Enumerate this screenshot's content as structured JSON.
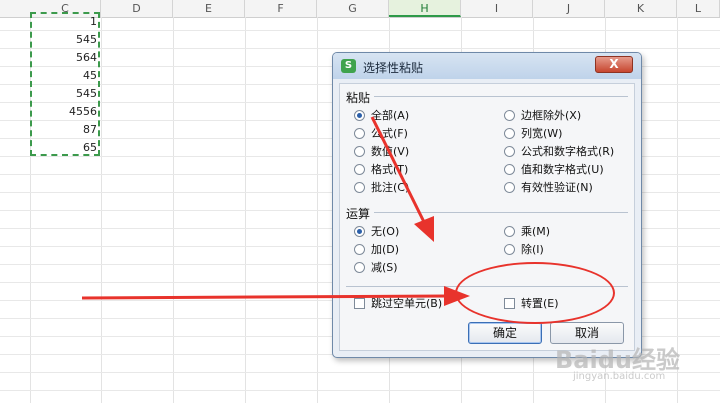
{
  "columns": [
    "C",
    "D",
    "E",
    "F",
    "G",
    "H",
    "I",
    "J",
    "K",
    "L"
  ],
  "selected_column": "H",
  "cells": [
    "1",
    "545",
    "564",
    "45",
    "545",
    "4556",
    "87",
    "65"
  ],
  "dialog": {
    "title": "选择性粘贴",
    "app_icon": "S",
    "close_label": "X",
    "paste_label": "粘贴",
    "paste_options": [
      {
        "label": "全部(A)",
        "checked": true
      },
      {
        "label": "公式(F)",
        "checked": false
      },
      {
        "label": "数值(V)",
        "checked": false
      },
      {
        "label": "格式(T)",
        "checked": false
      },
      {
        "label": "批注(C)",
        "checked": false
      },
      {
        "label": "边框除外(X)",
        "checked": false
      },
      {
        "label": "列宽(W)",
        "checked": false
      },
      {
        "label": "公式和数字格式(R)",
        "checked": false
      },
      {
        "label": "值和数字格式(U)",
        "checked": false
      },
      {
        "label": "有效性验证(N)",
        "checked": false
      }
    ],
    "operation_label": "运算",
    "operation_options": [
      {
        "label": "无(O)",
        "checked": true
      },
      {
        "label": "加(D)",
        "checked": false
      },
      {
        "label": "减(S)",
        "checked": false
      },
      {
        "label": "乘(M)",
        "checked": false
      },
      {
        "label": "除(I)",
        "checked": false
      }
    ],
    "skip_blanks_label": "跳过空单元(B)",
    "transpose_label": "转置(E)",
    "ok_label": "确定",
    "cancel_label": "取消"
  },
  "watermark": {
    "brand": "Baidu经验",
    "url": "jingyan.baidu.com"
  },
  "colors": {
    "arrow": "#e8332c",
    "selection": "#3c9a4c",
    "accent": "#2b5fa9"
  }
}
